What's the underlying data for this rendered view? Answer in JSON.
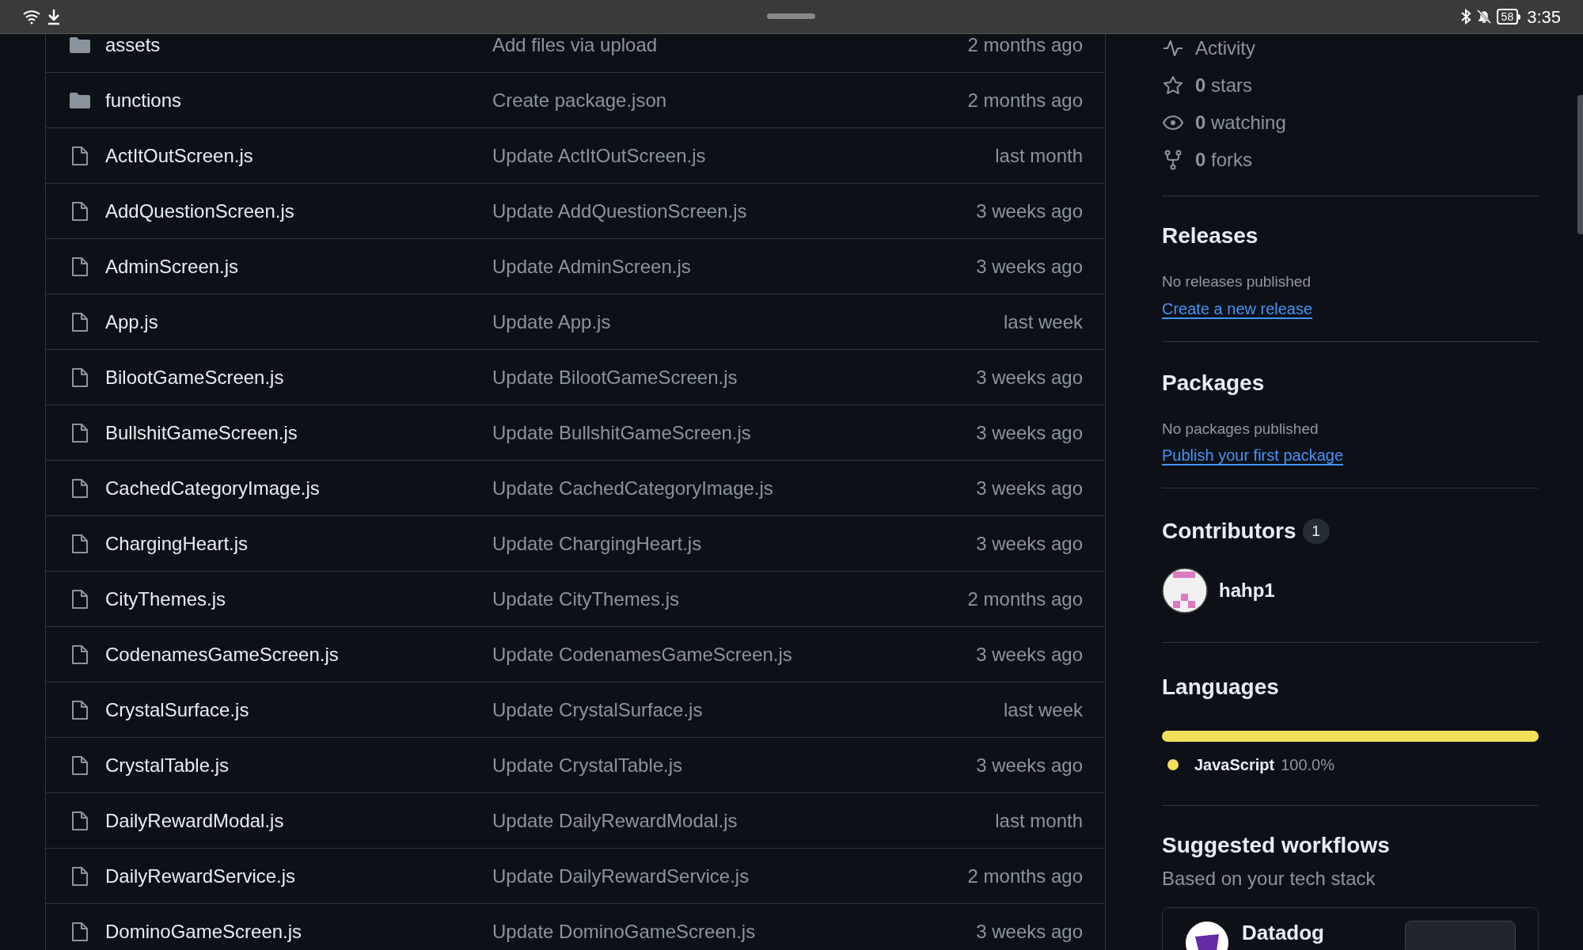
{
  "status_bar": {
    "battery": "58",
    "time": "3:35"
  },
  "files": [
    {
      "kind": "folder",
      "name": "assets",
      "message": "Add files via upload",
      "time": "2 months ago"
    },
    {
      "kind": "folder",
      "name": "functions",
      "message": "Create package.json",
      "time": "2 months ago"
    },
    {
      "kind": "file",
      "name": "ActItOutScreen.js",
      "message": "Update ActItOutScreen.js",
      "time": "last month"
    },
    {
      "kind": "file",
      "name": "AddQuestionScreen.js",
      "message": "Update AddQuestionScreen.js",
      "time": "3 weeks ago"
    },
    {
      "kind": "file",
      "name": "AdminScreen.js",
      "message": "Update AdminScreen.js",
      "time": "3 weeks ago"
    },
    {
      "kind": "file",
      "name": "App.js",
      "message": "Update App.js",
      "time": "last week"
    },
    {
      "kind": "file",
      "name": "BilootGameScreen.js",
      "message": "Update BilootGameScreen.js",
      "time": "3 weeks ago"
    },
    {
      "kind": "file",
      "name": "BullshitGameScreen.js",
      "message": "Update BullshitGameScreen.js",
      "time": "3 weeks ago"
    },
    {
      "kind": "file",
      "name": "CachedCategoryImage.js",
      "message": "Update CachedCategoryImage.js",
      "time": "3 weeks ago"
    },
    {
      "kind": "file",
      "name": "ChargingHeart.js",
      "message": "Update ChargingHeart.js",
      "time": "3 weeks ago"
    },
    {
      "kind": "file",
      "name": "CityThemes.js",
      "message": "Update CityThemes.js",
      "time": "2 months ago"
    },
    {
      "kind": "file",
      "name": "CodenamesGameScreen.js",
      "message": "Update CodenamesGameScreen.js",
      "time": "3 weeks ago"
    },
    {
      "kind": "file",
      "name": "CrystalSurface.js",
      "message": "Update CrystalSurface.js",
      "time": "last week"
    },
    {
      "kind": "file",
      "name": "CrystalTable.js",
      "message": "Update CrystalTable.js",
      "time": "3 weeks ago"
    },
    {
      "kind": "file",
      "name": "DailyRewardModal.js",
      "message": "Update DailyRewardModal.js",
      "time": "last month"
    },
    {
      "kind": "file",
      "name": "DailyRewardService.js",
      "message": "Update DailyRewardService.js",
      "time": "2 months ago"
    },
    {
      "kind": "file",
      "name": "DominoGameScreen.js",
      "message": "Update DominoGameScreen.js",
      "time": "3 weeks ago"
    }
  ],
  "sidebar": {
    "stats": [
      {
        "kind": "activity",
        "label": "Activity"
      },
      {
        "kind": "stars",
        "count": "0",
        "label": "stars"
      },
      {
        "kind": "watching",
        "count": "0",
        "label": "watching"
      },
      {
        "kind": "forks",
        "count": "0",
        "label": "forks"
      }
    ],
    "releases": {
      "title": "Releases",
      "note": "No releases published",
      "link": "Create a new release"
    },
    "packages": {
      "title": "Packages",
      "note": "No packages published",
      "link": "Publish your first package"
    },
    "contributors": {
      "title": "Contributors",
      "count": "1",
      "people": [
        {
          "name": "hahp1"
        }
      ]
    },
    "languages": {
      "title": "Languages",
      "items": [
        {
          "name": "JavaScript",
          "percent": "100.0%",
          "color": "#f1e05a",
          "level": 1
        }
      ]
    },
    "workflows": {
      "title": "Suggested workflows",
      "subtitle": "Based on your tech stack",
      "cards": [
        {
          "name": "Datadog"
        }
      ]
    }
  }
}
